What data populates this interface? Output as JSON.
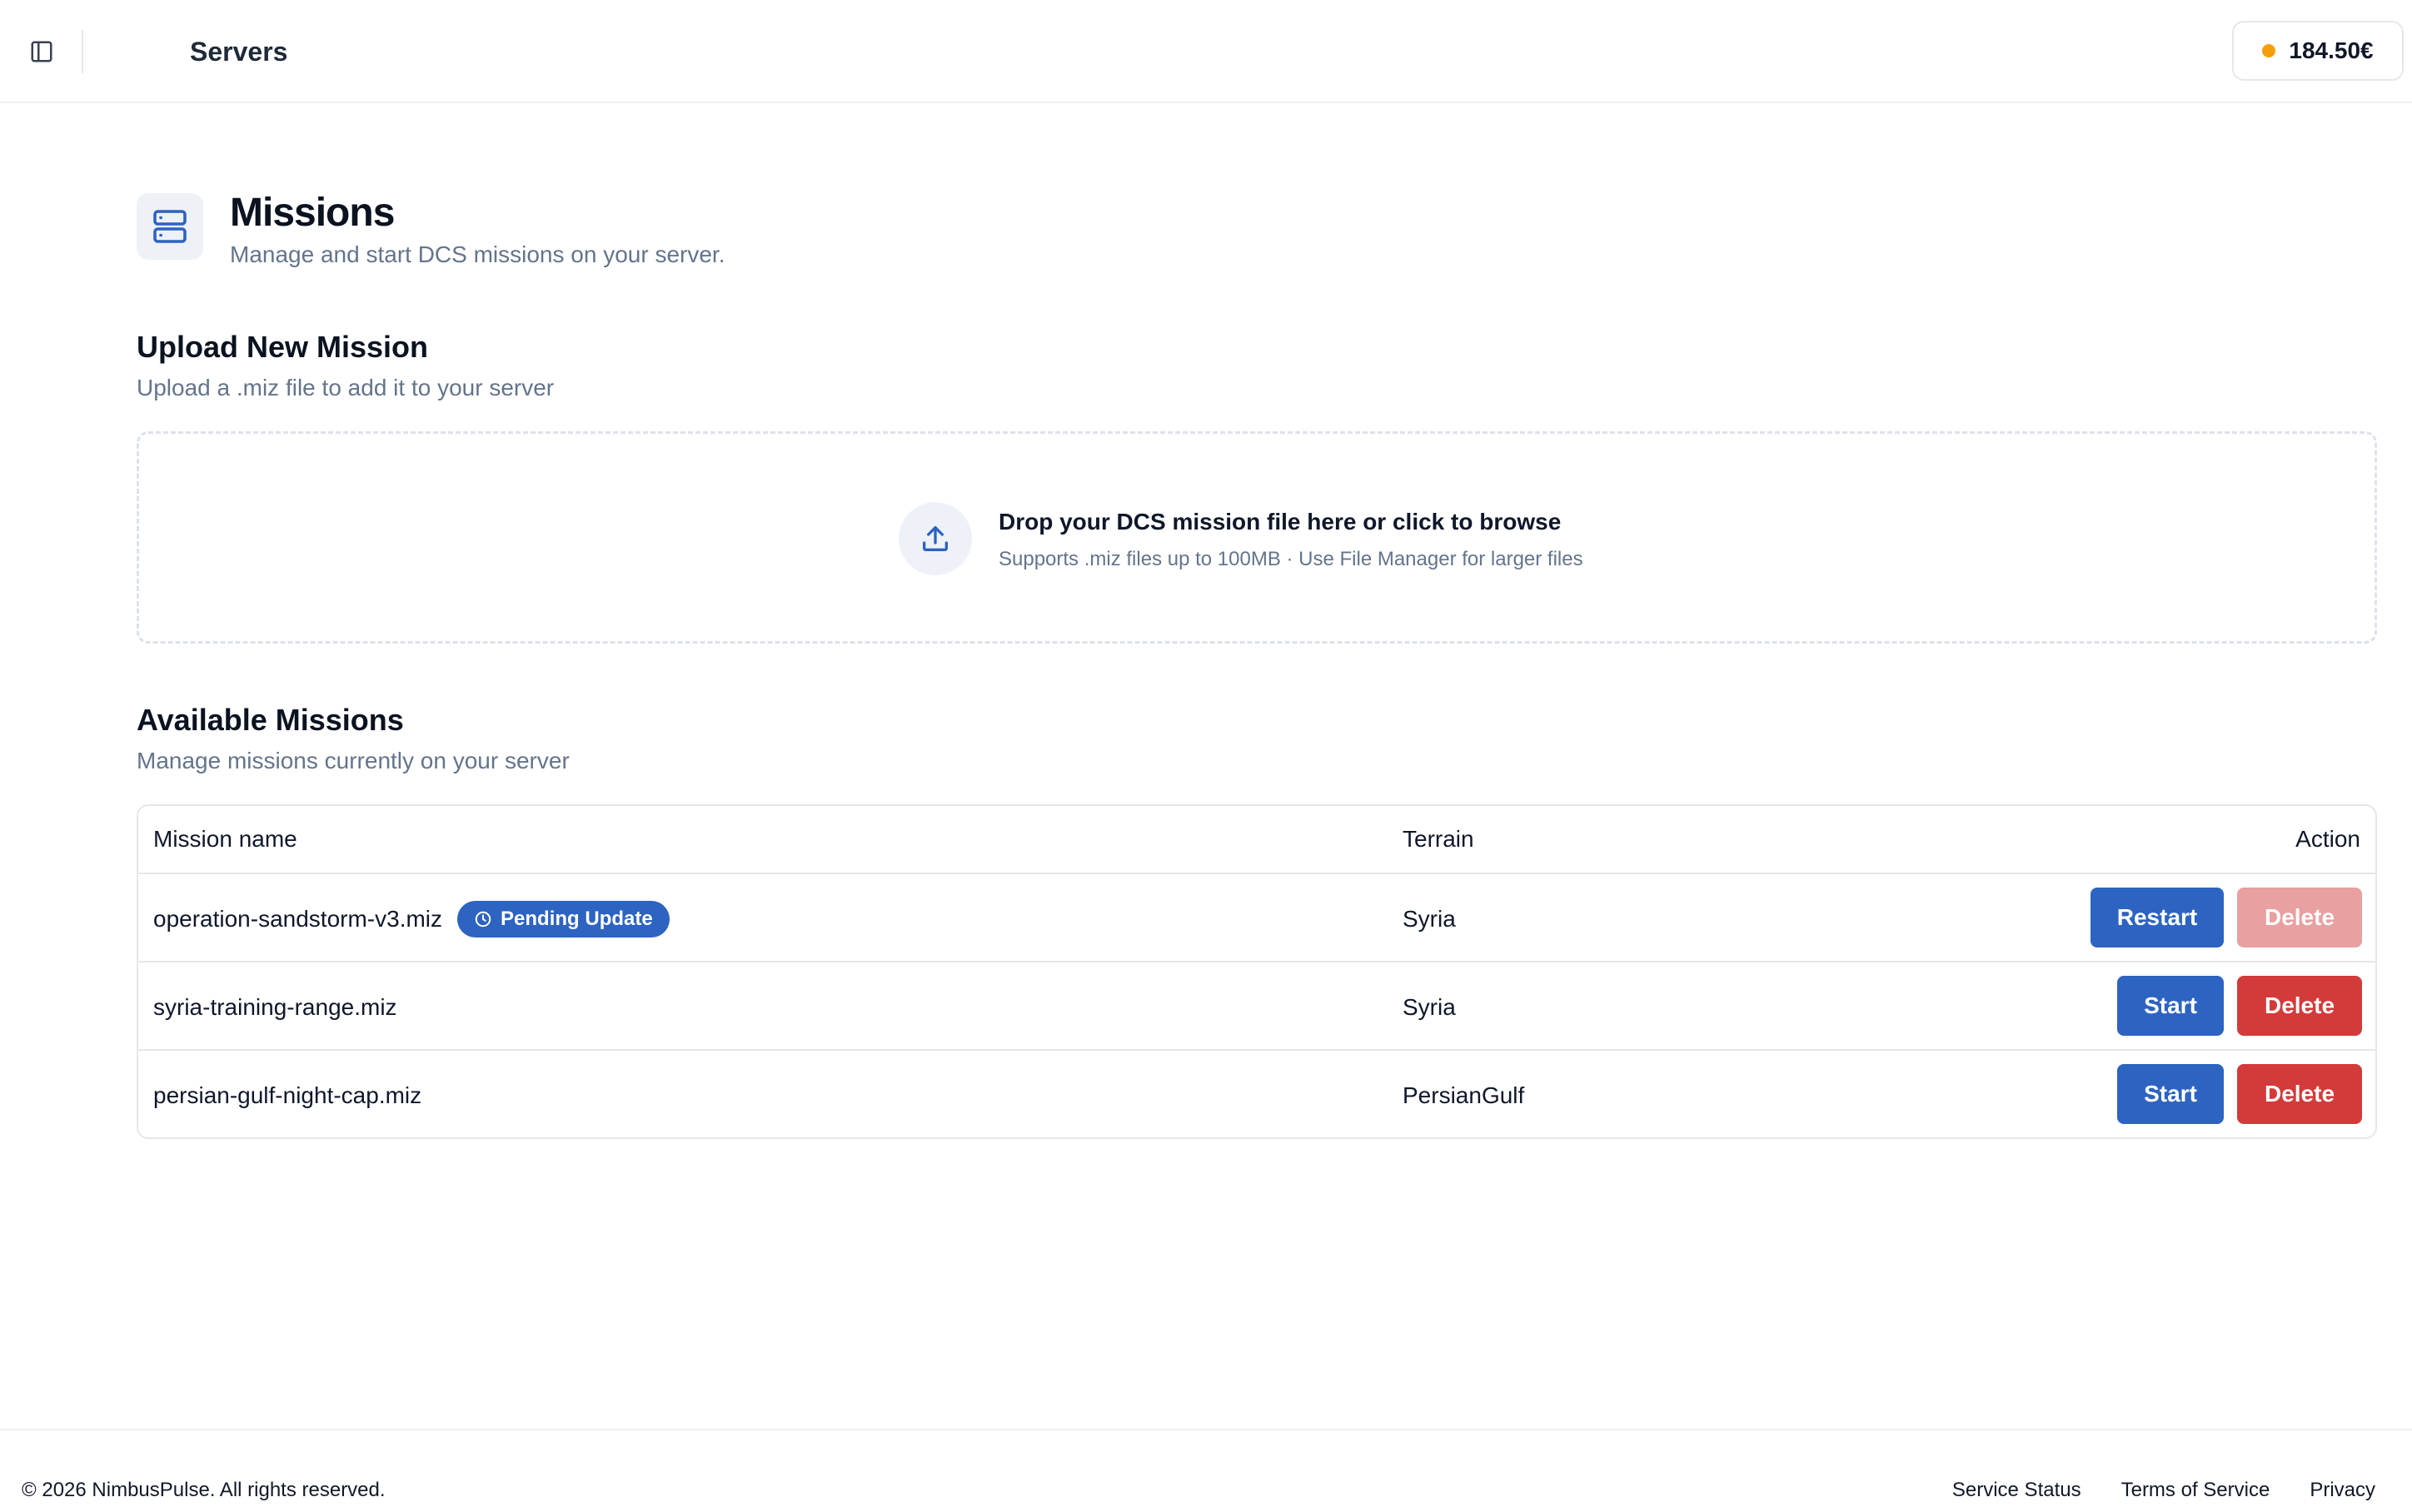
{
  "header": {
    "title": "Servers",
    "balance": "184.50€",
    "balance_dot_color": "#f59e0b"
  },
  "hero": {
    "title": "Missions",
    "subtitle": "Manage and start DCS missions on your server.",
    "icon": "server-icon"
  },
  "upload": {
    "title": "Upload New Mission",
    "subtitle": "Upload a .miz file to add it to your server",
    "drop_title": "Drop your DCS mission file here or click to browse",
    "drop_subtitle": "Supports .miz files up to 100MB · Use File Manager for larger files",
    "icon": "upload-icon"
  },
  "missions": {
    "title": "Available Missions",
    "subtitle": "Manage missions currently on your server",
    "columns": {
      "name": "Mission name",
      "terrain": "Terrain",
      "action": "Action"
    },
    "rows": [
      {
        "name": "operation-sandstorm-v3.miz",
        "badge": "Pending Update",
        "terrain": "Syria",
        "primary_action": "Restart",
        "secondary_action": "Delete",
        "delete_disabled": true
      },
      {
        "name": "syria-training-range.miz",
        "terrain": "Syria",
        "primary_action": "Start",
        "secondary_action": "Delete",
        "delete_disabled": false
      },
      {
        "name": "persian-gulf-night-cap.miz",
        "terrain": "PersianGulf",
        "primary_action": "Start",
        "secondary_action": "Delete",
        "delete_disabled": false
      }
    ]
  },
  "footer": {
    "copyright": "© 2026 NimbusPulse. All rights reserved.",
    "links": [
      "Service Status",
      "Terms of Service",
      "Privacy"
    ]
  },
  "colors": {
    "primary": "#2d63c1",
    "danger": "#d33a3a",
    "danger_disabled": "#e8a0a0",
    "muted_text": "#64748b"
  }
}
